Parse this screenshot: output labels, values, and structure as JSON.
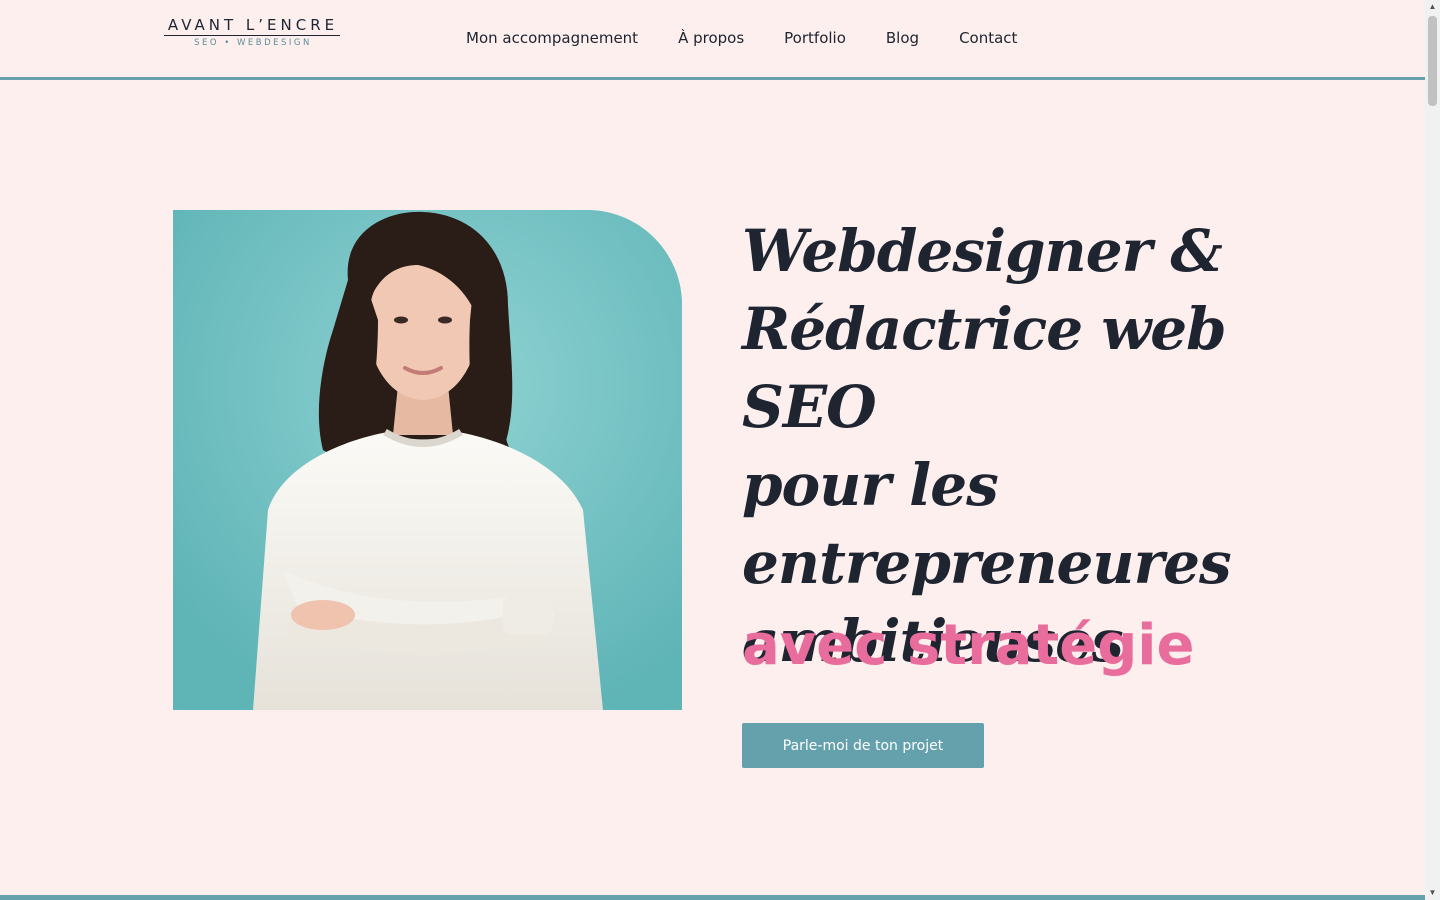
{
  "logo": {
    "title": "AVANT L’ENCRE",
    "subtitle": "SEO • WEBDESIGN"
  },
  "nav": {
    "items": [
      {
        "label": "Mon accompagnement"
      },
      {
        "label": "À propos"
      },
      {
        "label": "Portfolio"
      },
      {
        "label": "Blog"
      },
      {
        "label": "Contact"
      }
    ]
  },
  "hero": {
    "title_lines": [
      "Webdesigner &",
      "Rédactrice web SEO",
      "pour les",
      "entrepreneures",
      "ambitieuses"
    ],
    "accent": "avec stratégie",
    "cta_label": "Parle-moi de ton projet",
    "photo_icon": "portrait-photo"
  },
  "colors": {
    "background": "#fcefed",
    "accent_teal": "#64a1ad",
    "accent_pink": "#e86d9c",
    "text_dark": "#1e2430",
    "photo_bg": "#7dc6c8"
  }
}
